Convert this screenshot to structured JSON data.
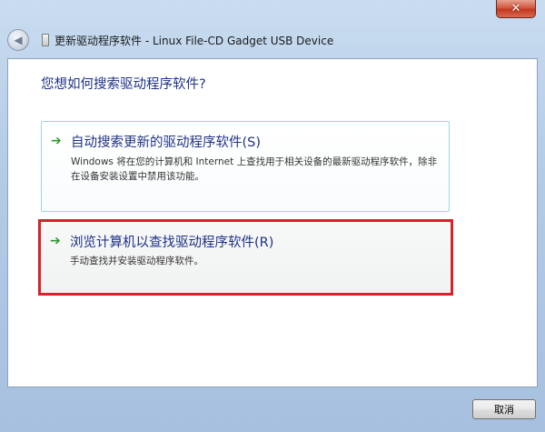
{
  "window": {
    "title": "更新驱动程序软件 - Linux File-CD Gadget USB Device",
    "close_glyph": "✕",
    "back_glyph": "◀"
  },
  "main": {
    "question": "您想如何搜索驱动程序软件?",
    "options": [
      {
        "title": "自动搜索更新的驱动程序软件(S)",
        "description": "Windows 将在您的计算机和 Internet 上查找用于相关设备的最新驱动程序软件，除非在设备安装设置中禁用该功能。",
        "icon": "green-arrow-icon"
      },
      {
        "title": "浏览计算机以查找驱动程序软件(R)",
        "description": "手动查找并安装驱动程序软件。",
        "icon": "green-arrow-icon"
      }
    ]
  },
  "footer": {
    "cancel_label": "取消"
  },
  "colors": {
    "link_blue": "#1e3287",
    "arrow_green": "#2c9a2c",
    "highlight_red": "#d9212c"
  }
}
